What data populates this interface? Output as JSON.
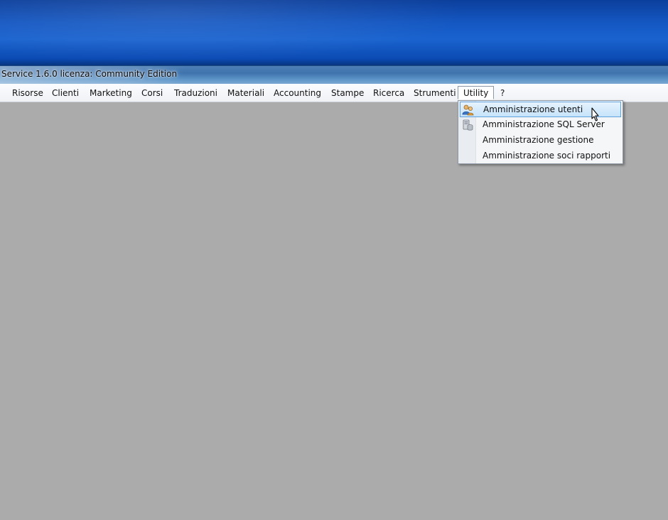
{
  "window": {
    "title": "Service 1.6.0 licenza: Community Edition"
  },
  "menubar": {
    "items": [
      {
        "label": "Risorse"
      },
      {
        "label": "Clienti"
      },
      {
        "label": "Marketing"
      },
      {
        "label": "Corsi"
      },
      {
        "label": "Traduzioni"
      },
      {
        "label": "Materiali"
      },
      {
        "label": "Accounting"
      },
      {
        "label": "Stampe"
      },
      {
        "label": "Ricerca"
      },
      {
        "label": "Strumenti"
      },
      {
        "label": "Utility"
      },
      {
        "label": "?"
      }
    ],
    "open_item": "Utility"
  },
  "utility_menu": {
    "items": [
      {
        "label": "Amministrazione utenti",
        "icon": "users-admin-icon",
        "highlighted": true
      },
      {
        "label": "Amministrazione SQL Server",
        "icon": "database-server-icon",
        "highlighted": false
      },
      {
        "label": "Amministrazione gestione",
        "icon": "",
        "highlighted": false
      },
      {
        "label": "Amministrazione soci rapporti",
        "icon": "",
        "highlighted": false
      }
    ]
  },
  "colors": {
    "desktop": "#1457c2",
    "workspace": "#ababab",
    "highlight_border": "#5fa2dd"
  }
}
